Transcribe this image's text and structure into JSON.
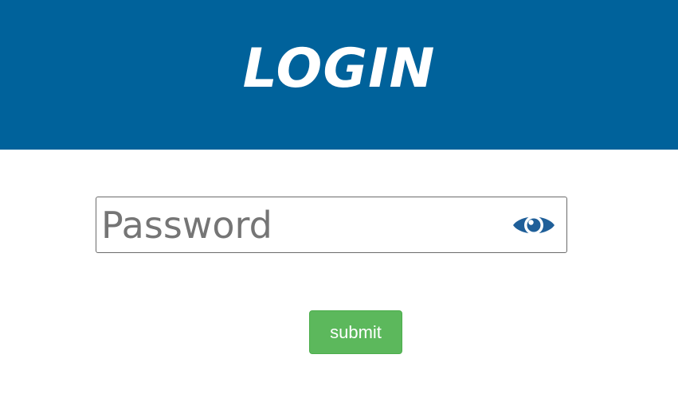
{
  "header": {
    "title": "LOGIN",
    "background_color": "#00629b"
  },
  "password_field": {
    "placeholder": "Password",
    "value": "",
    "toggle_icon": "eye-icon"
  },
  "submit": {
    "label": "submit",
    "background_color": "#5cb85c"
  }
}
